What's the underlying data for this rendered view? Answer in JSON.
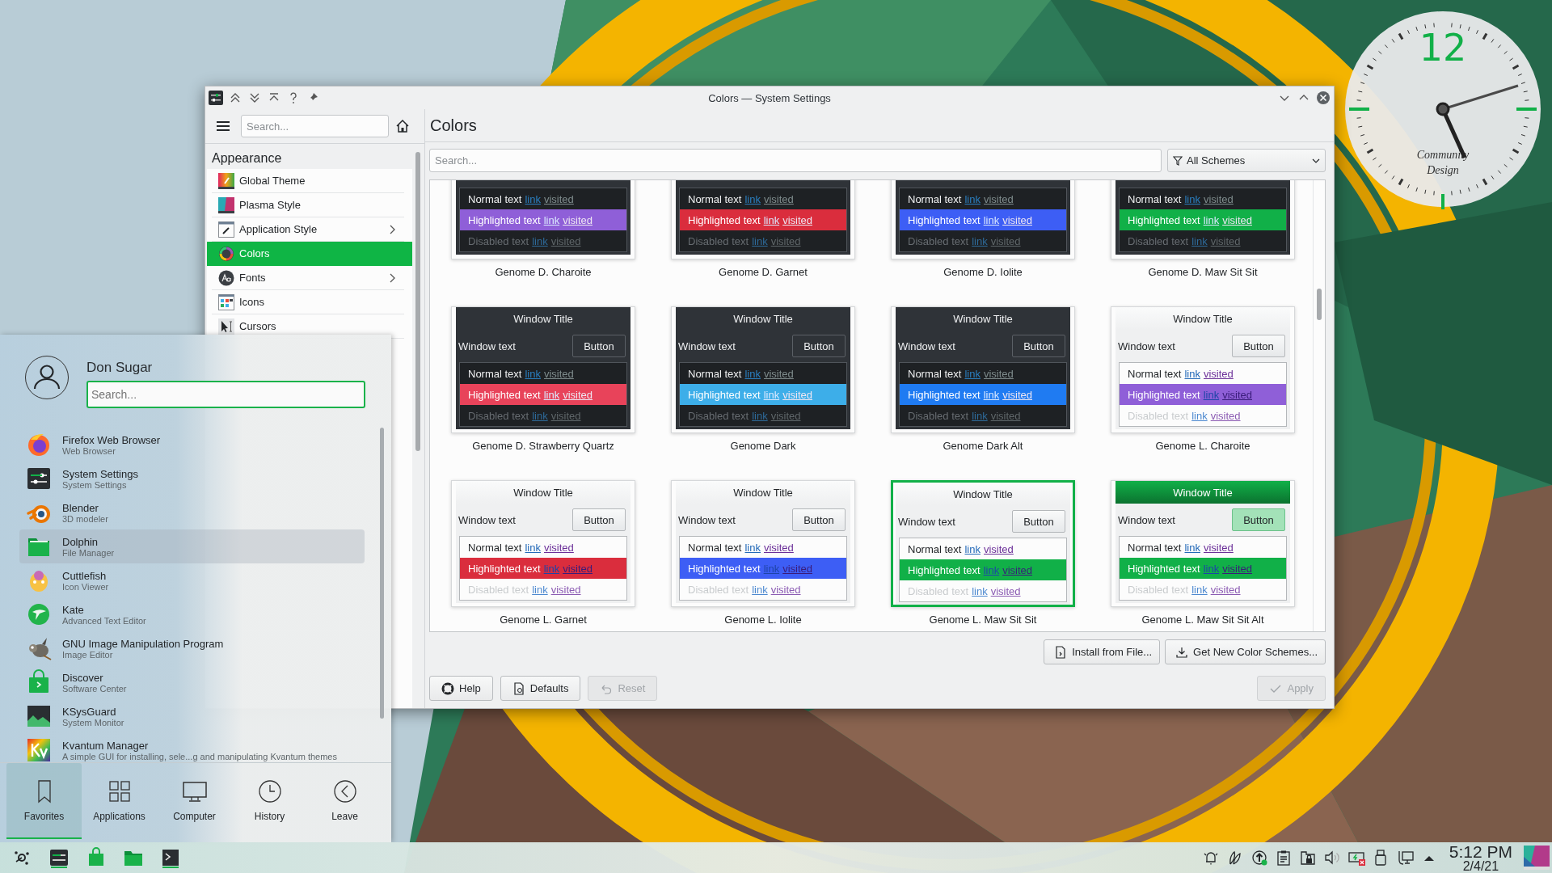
{
  "window": {
    "title": "Colors — System Settings"
  },
  "sidebar": {
    "search": {
      "placeholder": "Search..."
    },
    "section": "Appearance",
    "items": [
      {
        "label": "Global Theme",
        "selected": false,
        "expandable": false
      },
      {
        "label": "Plasma Style",
        "selected": false,
        "expandable": false
      },
      {
        "label": "Application Style",
        "selected": false,
        "expandable": true
      },
      {
        "label": "Colors",
        "selected": true,
        "expandable": false
      },
      {
        "label": "Fonts",
        "selected": false,
        "expandable": true
      },
      {
        "label": "Icons",
        "selected": false,
        "expandable": false
      },
      {
        "label": "Cursors",
        "selected": false,
        "expandable": false
      }
    ]
  },
  "page": {
    "title": "Colors",
    "search": {
      "placeholder": "Search..."
    },
    "filter": "All Schemes",
    "schemes": [
      {
        "name": "Genome D. Charoite",
        "kind": "dark",
        "color": "#8f5fd8",
        "selected": false,
        "rows": [
          {
            "kind": "normal",
            "label": "Normal text",
            "link": "link",
            "visited": "visited"
          },
          {
            "kind": "highlighted",
            "label": "Highlighted text",
            "link": "link",
            "visited": "visited"
          },
          {
            "kind": "disabled",
            "label": "Disabled text",
            "link": "link",
            "visited": "visited"
          }
        ]
      },
      {
        "name": "Genome D. Garnet",
        "kind": "dark",
        "color": "#da2d3d",
        "selected": false,
        "rows": [
          {
            "kind": "normal",
            "label": "Normal text",
            "link": "link",
            "visited": "visited"
          },
          {
            "kind": "highlighted",
            "label": "Highlighted text",
            "link": "link",
            "visited": "visited"
          },
          {
            "kind": "disabled",
            "label": "Disabled text",
            "link": "link",
            "visited": "visited"
          }
        ]
      },
      {
        "name": "Genome D. Iolite",
        "kind": "dark",
        "color": "#3d5ef5",
        "selected": false,
        "rows": [
          {
            "kind": "normal",
            "label": "Normal text",
            "link": "link",
            "visited": "visited"
          },
          {
            "kind": "highlighted",
            "label": "Highlighted text",
            "link": "link",
            "visited": "visited"
          },
          {
            "kind": "disabled",
            "label": "Disabled text",
            "link": "link",
            "visited": "visited"
          }
        ]
      },
      {
        "name": "Genome D. Maw Sit Sit",
        "kind": "dark",
        "color": "#11b048",
        "selected": false,
        "rows": [
          {
            "kind": "normal",
            "label": "Normal text",
            "link": "link",
            "visited": "visited"
          },
          {
            "kind": "highlighted",
            "label": "Highlighted text",
            "link": "link",
            "visited": "visited"
          },
          {
            "kind": "disabled",
            "label": "Disabled text",
            "link": "link",
            "visited": "visited"
          }
        ]
      },
      {
        "name": "Genome D. Strawberry Quartz",
        "kind": "dark",
        "color": "#e8435a",
        "selected": false,
        "window": {
          "title": "Window Title",
          "text": "Window text",
          "button": "Button"
        },
        "rows": [
          {
            "kind": "normal",
            "label": "Normal text",
            "link": "link",
            "visited": "visited"
          },
          {
            "kind": "highlighted",
            "label": "Highlighted text",
            "link": "link",
            "visited": "visited"
          },
          {
            "kind": "disabled",
            "label": "Disabled text",
            "link": "link",
            "visited": "visited"
          }
        ]
      },
      {
        "name": "Genome Dark",
        "kind": "dark",
        "color": "#3daee9",
        "selected": false,
        "window": {
          "title": "Window Title",
          "text": "Window text",
          "button": "Button"
        },
        "rows": [
          {
            "kind": "normal",
            "label": "Normal text",
            "link": "link",
            "visited": "visited"
          },
          {
            "kind": "highlighted",
            "label": "Highlighted text",
            "link": "link",
            "visited": "visited"
          },
          {
            "kind": "disabled",
            "label": "Disabled text",
            "link": "link",
            "visited": "visited"
          }
        ]
      },
      {
        "name": "Genome Dark Alt",
        "kind": "dark",
        "color": "#1f7bf2",
        "selected": false,
        "window": {
          "title": "Window Title",
          "text": "Window text",
          "button": "Button"
        },
        "rows": [
          {
            "kind": "normal",
            "label": "Normal text",
            "link": "link",
            "visited": "visited"
          },
          {
            "kind": "highlighted",
            "label": "Highlighted text",
            "link": "link",
            "visited": "visited"
          },
          {
            "kind": "disabled",
            "label": "Disabled text",
            "link": "link",
            "visited": "visited"
          }
        ]
      },
      {
        "name": "Genome L. Charoite",
        "kind": "light",
        "color": "#8f5fd8",
        "selected": false,
        "window": {
          "title": "Window Title",
          "text": "Window text",
          "button": "Button"
        },
        "rows": [
          {
            "kind": "normal",
            "label": "Normal text",
            "link": "link",
            "visited": "visited"
          },
          {
            "kind": "highlighted",
            "label": "Highlighted text",
            "link": "link",
            "visited": "visited"
          },
          {
            "kind": "disabled",
            "label": "Disabled text",
            "link": "link",
            "visited": "visited"
          }
        ]
      },
      {
        "name": "Genome L. Garnet",
        "kind": "light",
        "color": "#da2d3d",
        "selected": false,
        "window": {
          "title": "Window Title",
          "text": "Window text",
          "button": "Button"
        },
        "rows": [
          {
            "kind": "normal",
            "label": "Normal text",
            "link": "link",
            "visited": "visited"
          },
          {
            "kind": "highlighted",
            "label": "Highlighted text",
            "link": "link",
            "visited": "visited"
          },
          {
            "kind": "disabled",
            "label": "Disabled text",
            "link": "link",
            "visited": "visited"
          }
        ]
      },
      {
        "name": "Genome L. Iolite",
        "kind": "light",
        "color": "#3d5ef5",
        "selected": false,
        "window": {
          "title": "Window Title",
          "text": "Window text",
          "button": "Button"
        },
        "rows": [
          {
            "kind": "normal",
            "label": "Normal text",
            "link": "link",
            "visited": "visited"
          },
          {
            "kind": "highlighted",
            "label": "Highlighted text",
            "link": "link",
            "visited": "visited"
          },
          {
            "kind": "disabled",
            "label": "Disabled text",
            "link": "link",
            "visited": "visited"
          }
        ]
      },
      {
        "name": "Genome L. Maw Sit Sit",
        "kind": "light",
        "color": "#11b048",
        "selected": true,
        "window": {
          "title": "Window Title",
          "text": "Window text",
          "button": "Button"
        },
        "rows": [
          {
            "kind": "normal",
            "label": "Normal text",
            "link": "link",
            "visited": "visited"
          },
          {
            "kind": "highlighted",
            "label": "Highlighted text",
            "link": "link",
            "visited": "visited"
          },
          {
            "kind": "disabled",
            "label": "Disabled text",
            "link": "link",
            "visited": "visited"
          }
        ]
      },
      {
        "name": "Genome L. Maw Sit Sit Alt",
        "kind": "accent",
        "color": "#11b048",
        "selected": false,
        "window": {
          "title": "Window Title",
          "text": "Window text",
          "button": "Button"
        },
        "rows": [
          {
            "kind": "normal",
            "label": "Normal text",
            "link": "link",
            "visited": "visited"
          },
          {
            "kind": "highlighted",
            "label": "Highlighted text",
            "link": "link",
            "visited": "visited"
          },
          {
            "kind": "disabled",
            "label": "Disabled text",
            "link": "link",
            "visited": "visited"
          }
        ]
      }
    ],
    "actions": [
      {
        "label": "Install from File...",
        "disabled": false
      },
      {
        "label": "Get New Color Schemes...",
        "disabled": false
      }
    ],
    "footer_left": [
      {
        "label": "Help",
        "disabled": false
      },
      {
        "label": "Defaults",
        "disabled": false
      },
      {
        "label": "Reset",
        "disabled": true
      }
    ],
    "footer_right": [
      {
        "label": "Apply",
        "disabled": true
      }
    ]
  },
  "launcher": {
    "user": "Don Sugar",
    "search": {
      "placeholder": "Search..."
    },
    "apps": [
      {
        "name": "Firefox Web Browser",
        "description": "Web Browser",
        "selected": false
      },
      {
        "name": "System Settings",
        "description": "System Settings",
        "selected": false
      },
      {
        "name": "Blender",
        "description": "3D modeler",
        "selected": false
      },
      {
        "name": "Dolphin",
        "description": "File Manager",
        "selected": true
      },
      {
        "name": "Cuttlefish",
        "description": "Icon Viewer",
        "selected": false
      },
      {
        "name": "Kate",
        "description": "Advanced Text Editor",
        "selected": false
      },
      {
        "name": "GNU Image Manipulation Program",
        "description": "Image Editor",
        "selected": false
      },
      {
        "name": "Discover",
        "description": "Software Center",
        "selected": false
      },
      {
        "name": "KSysGuard",
        "description": "System Monitor",
        "selected": false
      },
      {
        "name": "Kvantum Manager",
        "description": "A simple GUI for installing, sele...g and manipulating Kvantum themes",
        "selected": false
      }
    ],
    "tabs": [
      {
        "label": "Favorites",
        "selected": true
      },
      {
        "label": "Applications",
        "selected": false
      },
      {
        "label": "Computer",
        "selected": false
      },
      {
        "label": "History",
        "selected": false
      },
      {
        "label": "Leave",
        "selected": false
      }
    ]
  },
  "clock_widget": {
    "hour_label": "12",
    "brand": [
      "Community",
      "Design"
    ]
  },
  "taskbar": {
    "time": "5:12 PM",
    "date": "2/4/21"
  }
}
